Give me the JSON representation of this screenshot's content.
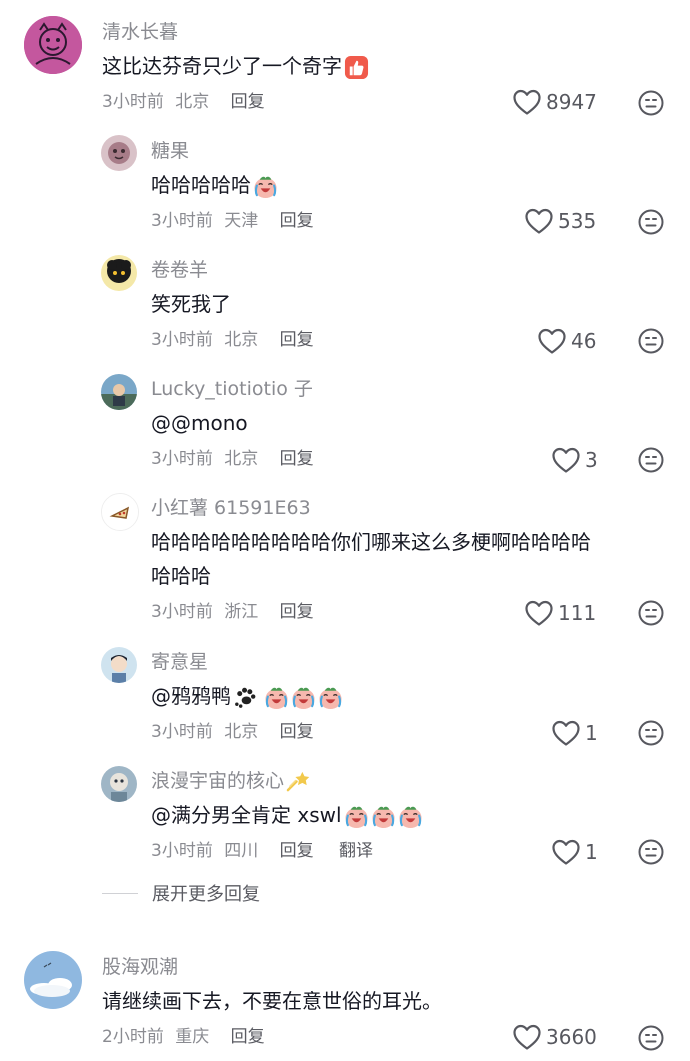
{
  "colors": {
    "text": "#161823",
    "secondary": "#8a8b91",
    "like_icon": "#57585f"
  },
  "comments": [
    {
      "username": "清水长暮",
      "text": "这比达芬奇只少了一个奇字",
      "text_emoji": "thumbs-up",
      "time": "3小时前",
      "location": "北京",
      "reply_label": "回复",
      "likes": "8947",
      "replies": [
        {
          "username": "糖果",
          "text": "哈哈哈哈哈",
          "text_emoji": "laughing-cry",
          "time": "3小时前",
          "location": "天津",
          "reply_label": "回复",
          "likes": "535"
        },
        {
          "username": "卷卷羊",
          "text": "笑死我了",
          "time": "3小时前",
          "location": "北京",
          "reply_label": "回复",
          "likes": "46"
        },
        {
          "username": "Lucky_tiotiotio 子",
          "text": "@@mono",
          "time": "3小时前",
          "location": "北京",
          "reply_label": "回复",
          "likes": "3"
        },
        {
          "username": "小红薯 61591E63",
          "text_line1": "哈哈哈哈哈哈哈哈哈你们哪来这么多梗啊哈哈哈哈",
          "text_line2": "哈哈哈",
          "time": "3小时前",
          "location": "浙江",
          "reply_label": "回复",
          "likes": "111"
        },
        {
          "username": "寄意星",
          "text": "@鸦鸦鸭",
          "text_emoji": "paw-prints, laughing-cry ×3",
          "time": "3小时前",
          "location": "北京",
          "reply_label": "回复",
          "likes": "1"
        },
        {
          "username": "浪漫宇宙的核心",
          "username_emoji": "shooting-star",
          "text": "@满分男全肯定 xswl",
          "text_emoji": "laughing-cry ×3",
          "time": "3小时前",
          "location": "四川",
          "reply_label": "回复",
          "translate_label": "翻译",
          "likes": "1"
        }
      ],
      "expand_label": "展开更多回复"
    },
    {
      "username": "股海观潮",
      "text": "请继续画下去，不要在意世俗的耳光。",
      "time": "2小时前",
      "location": "重庆",
      "reply_label": "回复",
      "likes": "3660"
    }
  ],
  "icons": {
    "like": "heart-outline-icon",
    "dislike": "meh-face-icon"
  }
}
